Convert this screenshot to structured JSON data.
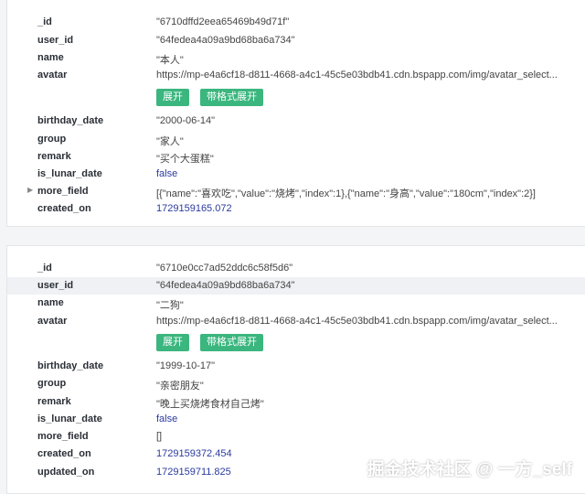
{
  "docs": [
    {
      "fields": [
        {
          "key": "_id",
          "value": "\"6710dffd2eea65469b49d71f\"",
          "type": "str"
        },
        {
          "key": "user_id",
          "value": "\"64fedea4a09a9bd68ba6a734\"",
          "type": "str"
        },
        {
          "key": "name",
          "value": "\"本人\"",
          "type": "str"
        },
        {
          "key": "avatar",
          "value": "https://mp-e4a6cf18-d811-4668-a4c1-45c5e03bdb41.cdn.bspapp.com/img/avatar_select...",
          "type": "str"
        },
        {
          "key": "birthday_date",
          "value": "\"2000-06-14\"",
          "type": "str"
        },
        {
          "key": "group",
          "value": "\"家人\"",
          "type": "str"
        },
        {
          "key": "remark",
          "value": "\"买个大蛋糕\"",
          "type": "str"
        },
        {
          "key": "is_lunar_date",
          "value": "false",
          "type": "bool"
        },
        {
          "key": "more_field",
          "value": "[{\"name\":\"喜欢吃\",\"value\":\"烧烤\",\"index\":1},{\"name\":\"身高\",\"value\":\"180cm\",\"index\":2}]",
          "type": "str"
        },
        {
          "key": "created_on",
          "value": "1729159165.072",
          "type": "num"
        }
      ],
      "expand_label": "展开",
      "format_expand_label": "带格式展开"
    },
    {
      "fields": [
        {
          "key": "_id",
          "value": "\"6710e0cc7ad52ddc6c58f5d6\"",
          "type": "str"
        },
        {
          "key": "user_id",
          "value": "\"64fedea4a09a9bd68ba6a734\"",
          "type": "str"
        },
        {
          "key": "name",
          "value": "\"二狗\"",
          "type": "str"
        },
        {
          "key": "avatar",
          "value": "https://mp-e4a6cf18-d811-4668-a4c1-45c5e03bdb41.cdn.bspapp.com/img/avatar_select...",
          "type": "str"
        },
        {
          "key": "birthday_date",
          "value": "\"1999-10-17\"",
          "type": "str"
        },
        {
          "key": "group",
          "value": "\"亲密朋友\"",
          "type": "str"
        },
        {
          "key": "remark",
          "value": "\"晚上买烧烤食材自己烤\"",
          "type": "str"
        },
        {
          "key": "is_lunar_date",
          "value": "false",
          "type": "bool"
        },
        {
          "key": "more_field",
          "value": "[]",
          "type": "str"
        },
        {
          "key": "created_on",
          "value": "1729159372.454",
          "type": "num"
        },
        {
          "key": "updated_on",
          "value": "1729159711.825",
          "type": "num"
        }
      ],
      "expand_label": "展开",
      "format_expand_label": "带格式展开"
    }
  ],
  "watermark": "掘金技术社区 @ 一方_self",
  "colors": {
    "button_green": "#3bb67e",
    "number_blue": "#2b3a9e",
    "key_text": "#2a2f36"
  }
}
